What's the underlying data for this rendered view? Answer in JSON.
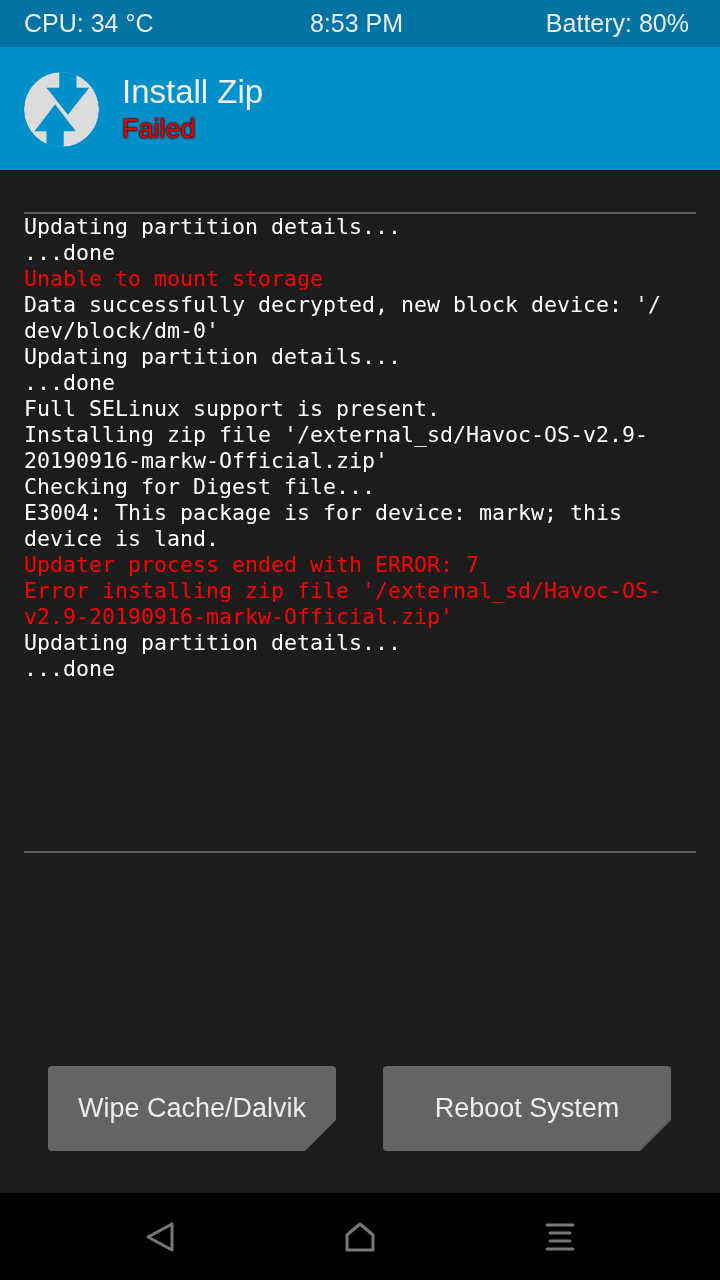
{
  "status_bar": {
    "cpu": "CPU: 34 °C",
    "time": "8:53 PM",
    "battery": "Battery: 80%"
  },
  "header": {
    "title": "Install Zip",
    "status": {
      "text": "Failed",
      "kind": "error"
    }
  },
  "console": [
    {
      "kind": "info",
      "lines": [
        "Updating partition details..."
      ]
    },
    {
      "kind": "info",
      "lines": [
        "...done"
      ]
    },
    {
      "kind": "error",
      "lines": [
        "Unable to mount storage"
      ]
    },
    {
      "kind": "info",
      "lines": [
        "Data successfully decrypted, new block device: '/",
        "dev/block/dm-0'"
      ]
    },
    {
      "kind": "info",
      "lines": [
        "Updating partition details..."
      ]
    },
    {
      "kind": "info",
      "lines": [
        "...done"
      ]
    },
    {
      "kind": "info",
      "lines": [
        "Full SELinux support is present."
      ]
    },
    {
      "kind": "info",
      "lines": [
        "Installing zip file '/external_sd/Havoc-OS-v2.9-",
        "20190916-markw-Official.zip'"
      ]
    },
    {
      "kind": "info",
      "lines": [
        "Checking for Digest file..."
      ]
    },
    {
      "kind": "info",
      "lines": [
        "E3004: This package is for device: markw; this",
        "device is land."
      ]
    },
    {
      "kind": "error",
      "lines": [
        "Updater process ended with ERROR: 7"
      ]
    },
    {
      "kind": "error",
      "lines": [
        "Error installing zip file '/external_sd/Havoc-OS-",
        "v2.9-20190916-markw-Official.zip'"
      ]
    },
    {
      "kind": "info",
      "lines": [
        "Updating partition details..."
      ]
    },
    {
      "kind": "info",
      "lines": [
        "...done"
      ]
    }
  ],
  "buttons": [
    {
      "label": "Wipe Cache/Dalvik"
    },
    {
      "label": "Reboot System"
    }
  ]
}
